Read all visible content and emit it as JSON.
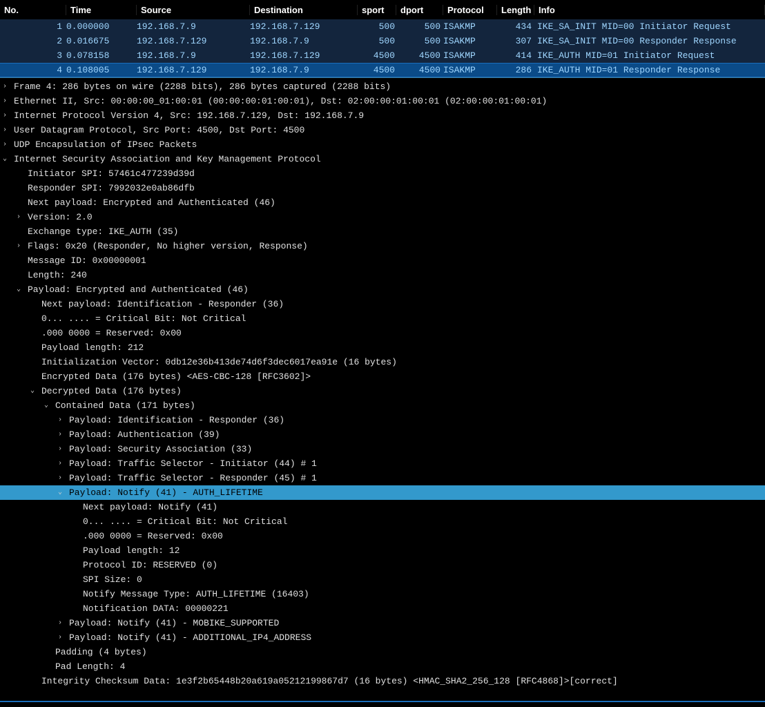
{
  "columns": {
    "no": "No.",
    "time": "Time",
    "src": "Source",
    "dst": "Destination",
    "sport": "sport",
    "dport": "dport",
    "proto": "Protocol",
    "len": "Length",
    "info": "Info"
  },
  "packets": [
    {
      "no": "1",
      "time": "0.000000",
      "src": "192.168.7.9",
      "dst": "192.168.7.129",
      "sport": "500",
      "dport": "500",
      "proto": "ISAKMP",
      "len": "434",
      "info": "IKE_SA_INIT MID=00 Initiator Request"
    },
    {
      "no": "2",
      "time": "0.016675",
      "src": "192.168.7.129",
      "dst": "192.168.7.9",
      "sport": "500",
      "dport": "500",
      "proto": "ISAKMP",
      "len": "307",
      "info": "IKE_SA_INIT MID=00 Responder Response"
    },
    {
      "no": "3",
      "time": "0.078158",
      "src": "192.168.7.9",
      "dst": "192.168.7.129",
      "sport": "4500",
      "dport": "4500",
      "proto": "ISAKMP",
      "len": "414",
      "info": "IKE_AUTH MID=01 Initiator Request"
    },
    {
      "no": "4",
      "time": "0.108005",
      "src": "192.168.7.129",
      "dst": "192.168.7.9",
      "sport": "4500",
      "dport": "4500",
      "proto": "ISAKMP",
      "len": "286",
      "info": "IKE_AUTH MID=01 Responder Response"
    }
  ],
  "selected_packet": 3,
  "details": {
    "frame": "Frame 4: 286 bytes on wire (2288 bits), 286 bytes captured (2288 bits)",
    "eth": "Ethernet II, Src: 00:00:00_01:00:01 (00:00:00:01:00:01), Dst: 02:00:00:01:00:01 (02:00:00:01:00:01)",
    "ip": "Internet Protocol Version 4, Src: 192.168.7.129, Dst: 192.168.7.9",
    "udp": "User Datagram Protocol, Src Port: 4500, Dst Port: 4500",
    "udpenc": "UDP Encapsulation of IPsec Packets",
    "isakmp": "Internet Security Association and Key Management Protocol",
    "isakmp_fields": {
      "ispi": "Initiator SPI: 57461c477239d39d",
      "rspi": "Responder SPI: 7992032e0ab86dfb",
      "next": "Next payload: Encrypted and Authenticated (46)",
      "ver": "Version: 2.0",
      "extype": "Exchange type: IKE_AUTH (35)",
      "flags": "Flags: 0x20 (Responder, No higher version, Response)",
      "mid": "Message ID: 0x00000001",
      "len": "Length: 240"
    },
    "enc_payload": "Payload: Encrypted and Authenticated (46)",
    "enc_fields": {
      "next": "Next payload: Identification - Responder (36)",
      "crit": "0... .... = Critical Bit: Not Critical",
      "resv": ".000 0000 = Reserved: 0x00",
      "plen": "Payload length: 212",
      "iv": "Initialization Vector: 0db12e36b413de74d6f3dec6017ea91e (16 bytes)",
      "edata": "Encrypted Data (176 bytes) <AES-CBC-128 [RFC3602]>"
    },
    "decrypted": "Decrypted Data (176 bytes)",
    "contained": "Contained Data (171 bytes)",
    "contained_payloads": {
      "id_r": "Payload: Identification - Responder (36)",
      "auth": "Payload: Authentication (39)",
      "sa": "Payload: Security Association (33)",
      "tsi": "Payload: Traffic Selector - Initiator (44) # 1",
      "tsr": "Payload: Traffic Selector - Responder (45) # 1"
    },
    "notify_auth": "Payload: Notify (41) - AUTH_LIFETIME",
    "notify_auth_fields": {
      "next": "Next payload: Notify (41)",
      "crit": "0... .... = Critical Bit: Not Critical",
      "resv": ".000 0000 = Reserved: 0x00",
      "plen": "Payload length: 12",
      "pid": "Protocol ID: RESERVED (0)",
      "spi": "SPI Size: 0",
      "mtype": "Notify Message Type: AUTH_LIFETIME (16403)",
      "data": "Notification DATA: 00000221"
    },
    "notify_mobike": "Payload: Notify (41) - MOBIKE_SUPPORTED",
    "notify_ip4": "Payload: Notify (41) - ADDITIONAL_IP4_ADDRESS",
    "padding": "Padding (4 bytes)",
    "padlen": "Pad Length: 4",
    "icv": "Integrity Checksum Data: 1e3f2b65448b20a619a05212199867d7 (16 bytes) <HMAC_SHA2_256_128 [RFC4868]>[correct]"
  }
}
